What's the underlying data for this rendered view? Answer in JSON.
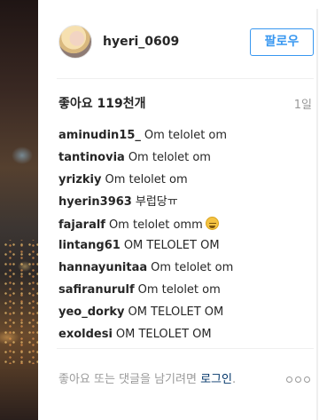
{
  "post": {
    "username": "hyeri_0609",
    "follow_label": "팔로우",
    "likes": "좋아요 119천개",
    "time_ago": "1일",
    "comments": [
      {
        "user": "aminudin15_",
        "text": "Om telolet om"
      },
      {
        "user": "tantinovia",
        "text": "Om telolet om"
      },
      {
        "user": "yrizkiy",
        "text": "Om telolet om"
      },
      {
        "user": "hyerin3963",
        "text": "부럽당ㅠ"
      },
      {
        "user": "fajaralf",
        "text": "Om telolet omm",
        "emoji": "sweat-face-emoji"
      },
      {
        "user": "lintang61",
        "text": "OM TELOLET OM"
      },
      {
        "user": "hannayunitaa",
        "text": "Om telolet om"
      },
      {
        "user": "safiranurulf",
        "text": "Om telolet om"
      },
      {
        "user": "yeo_dorky",
        "text": "OM TELOLET OM"
      },
      {
        "user": "exoldesi",
        "text": "OM TELOLET OM"
      }
    ],
    "footer": {
      "prefix": "좋아요 또는 댓글을 남기려면 ",
      "login_link": "로그인",
      "suffix": "."
    },
    "more_icon": "more-options-icon"
  },
  "colors": {
    "accent": "#3897f0",
    "text": "#262626",
    "muted": "#999999",
    "link": "#003569",
    "divider": "#efefef"
  }
}
